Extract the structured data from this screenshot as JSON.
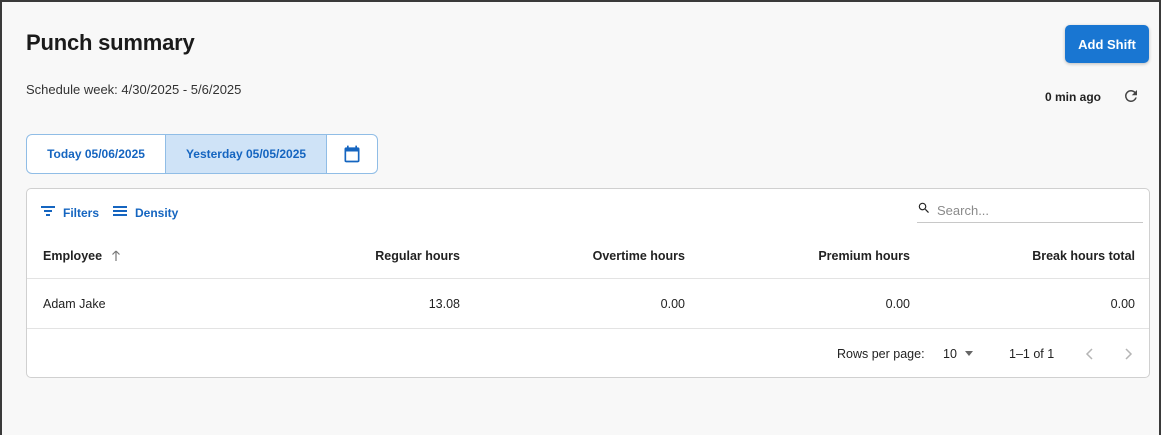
{
  "page": {
    "title": "Punch summary",
    "add_shift_label": "Add Shift",
    "schedule_week": "Schedule week: 4/30/2025 - 5/6/2025",
    "last_updated": "0 min ago"
  },
  "day_selector": {
    "today_label": "Today 05/06/2025",
    "yesterday_label": "Yesterday 05/05/2025",
    "selected": "yesterday"
  },
  "toolbar": {
    "filters_label": "Filters",
    "density_label": "Density",
    "search_placeholder": "Search..."
  },
  "table": {
    "columns": [
      "Employee",
      "Regular hours",
      "Overtime hours",
      "Premium hours",
      "Break hours total"
    ],
    "sort": {
      "column": "Employee",
      "direction": "ascending"
    },
    "rows": [
      {
        "employee": "Adam Jake",
        "regular": "13.08",
        "overtime": "0.00",
        "premium": "0.00",
        "break_total": "0.00"
      }
    ]
  },
  "pagination": {
    "rows_per_page_label": "Rows per page:",
    "rows_per_page": "10",
    "range": "1–1 of 1"
  },
  "colors": {
    "accent": "#1976d2",
    "selected_bg": "#cfe3f7",
    "border": "#90bde6"
  },
  "icons": [
    "refresh-icon",
    "calendar-icon",
    "filter-icon",
    "density-icon",
    "search-icon",
    "sort-arrow-up-icon",
    "dropdown-arrow-icon",
    "chevron-left-icon",
    "chevron-right-icon"
  ]
}
